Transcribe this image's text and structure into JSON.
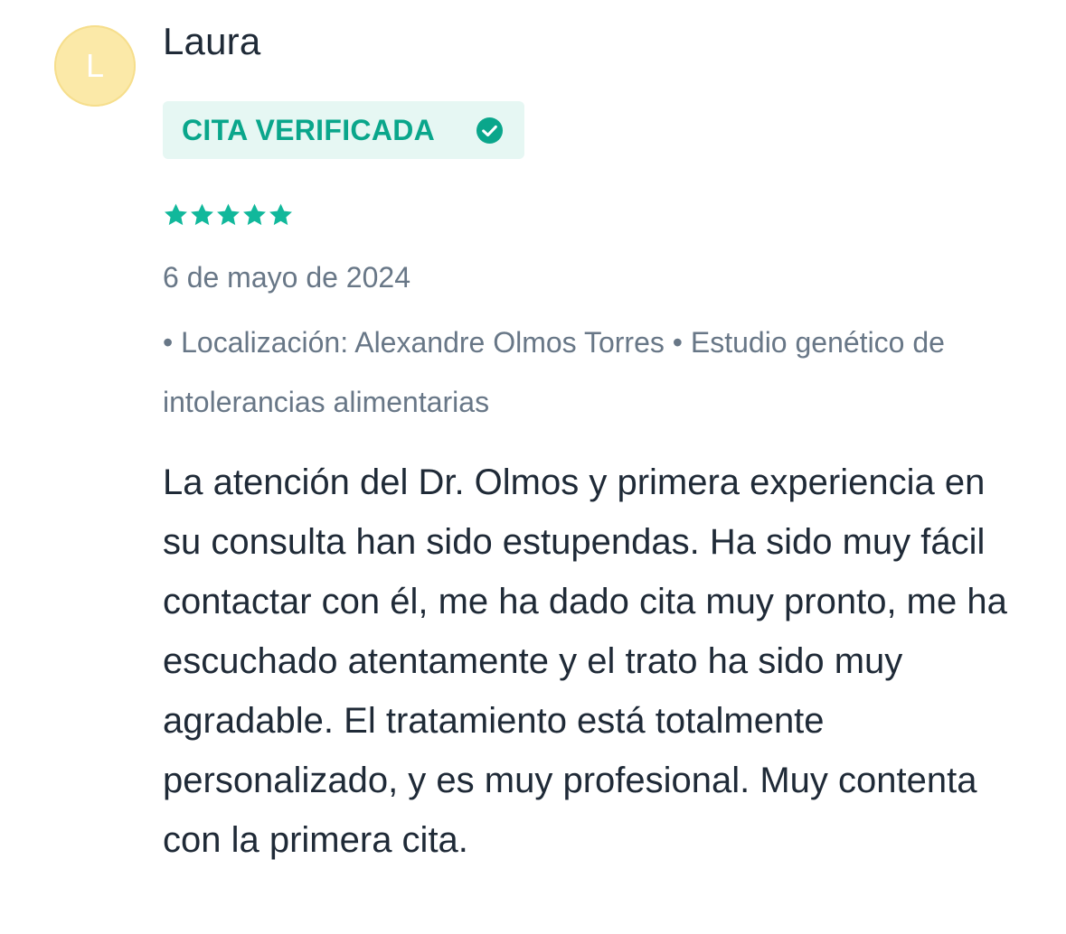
{
  "review": {
    "avatar_letter": "L",
    "author": "Laura",
    "badge": {
      "label": "CITA VERIFICADA",
      "icon": "check-circle-icon",
      "color": "#0aa68b",
      "background": "#e6f7f3"
    },
    "rating": {
      "value": 5,
      "max": 5,
      "star_color": "#11b89b"
    },
    "date": "6 de mayo de 2024",
    "meta": "• Localización: Alexandre Olmos Torres • Estudio genético de intolerancias alimentarias",
    "text": "La atención del Dr. Olmos y primera experiencia en su consulta han sido estupendas. Ha sido muy fácil contactar con él, me ha dado cita muy pronto, me ha escuchado atentamente y el trato ha sido muy agradable. El tratamiento está totalmente personalizado, y es muy profesional. Muy contenta con la primera cita."
  }
}
